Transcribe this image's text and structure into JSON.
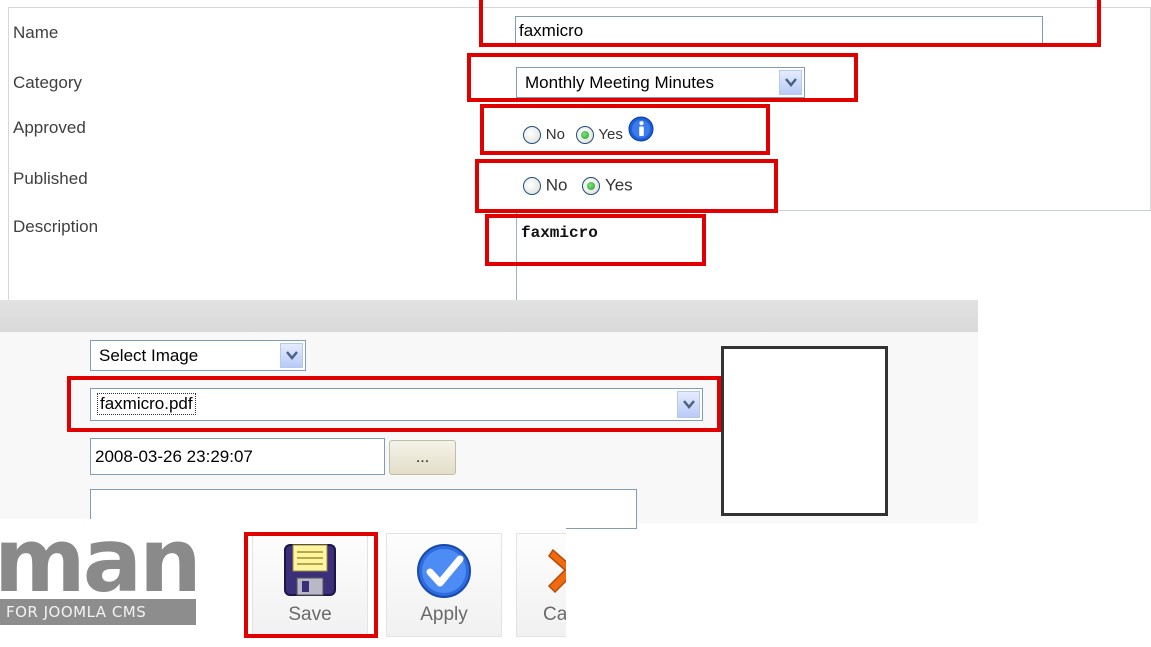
{
  "form": {
    "labels": {
      "name": "Name",
      "category": "Category",
      "approved": "Approved",
      "published": "Published",
      "description": "Description"
    },
    "name_value": "faxmicro",
    "category_value": "Monthly Meeting Minutes",
    "approved": {
      "no_label": "No",
      "yes_label": "Yes",
      "selected": "Yes"
    },
    "published": {
      "no_label": "No",
      "yes_label": "Yes",
      "selected": "Yes"
    },
    "description_value": "faxmicro"
  },
  "file": {
    "image_select_value": "Select Image",
    "file_select_value": "faxmicro.pdf",
    "date_value": "2008-03-26 23:29:07",
    "date_button_label": "..."
  },
  "toolbar": {
    "logo_text": "man",
    "logo_tagline": "FOR JOOMLA CMS",
    "save_label": "Save",
    "apply_label": "Apply",
    "cancel_label_visible": "Ca"
  },
  "colors": {
    "highlight": "#e00000",
    "input_border": "#7f9db9",
    "logo_gray": "#8a8a8a"
  }
}
